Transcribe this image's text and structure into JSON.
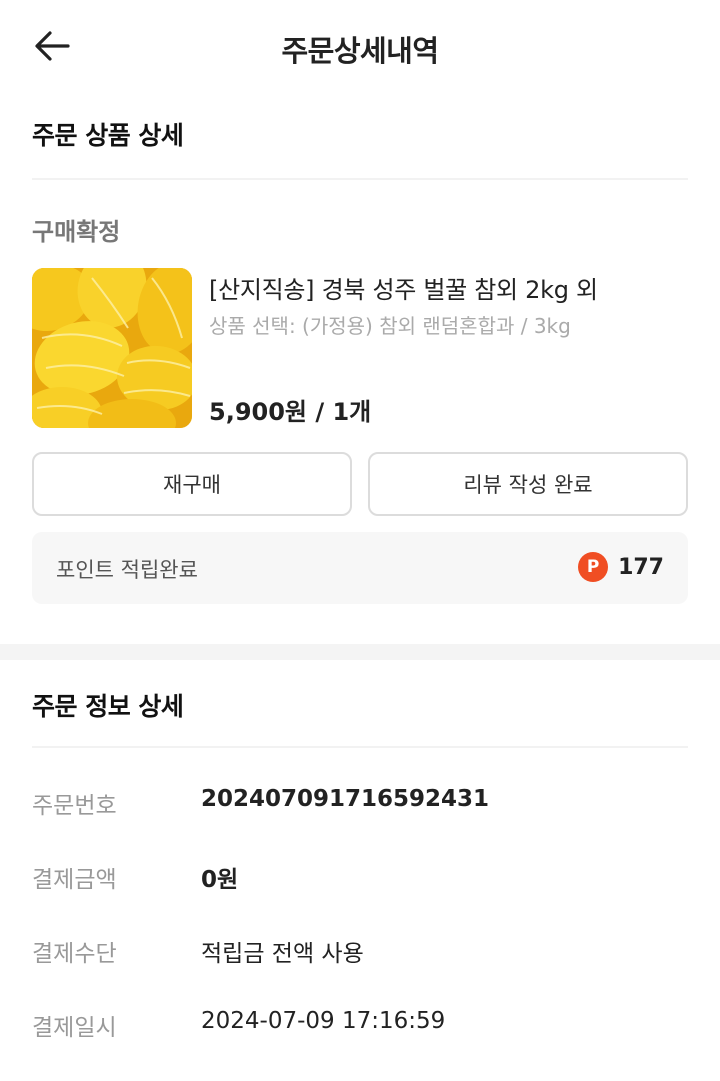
{
  "header": {
    "title": "주문상세내역",
    "back_icon": "arrow-left-icon"
  },
  "order_items": {
    "section_title": "주문 상품 상세",
    "status": "구매확정",
    "product": {
      "image": "yellow-melon-photo",
      "name": "[산지직송] 경북 성주 벌꿀 참외 2kg 외",
      "option": "상품 선택: (가정용) 참외 랜덤혼합과 / 3kg",
      "price": "5,900원 / 1개"
    },
    "buttons": {
      "rebuy": "재구매",
      "review": "리뷰 작성 완료"
    },
    "points": {
      "label": "포인트 적립완료",
      "icon_letter": "P",
      "value": "177"
    }
  },
  "order_info": {
    "section_title": "주문 정보 상세",
    "rows": [
      {
        "label": "주문번호",
        "value": "20240709171659​2431"
      },
      {
        "label": "결제금액",
        "value": "0원"
      },
      {
        "label": "결제수단",
        "value": "적립금 전액 사용"
      },
      {
        "label": "결제일시",
        "value": "2024-07-09 17:16:59"
      }
    ]
  },
  "colors": {
    "point_badge": "#f04e23",
    "melon_yellow": "#f3c21c"
  }
}
